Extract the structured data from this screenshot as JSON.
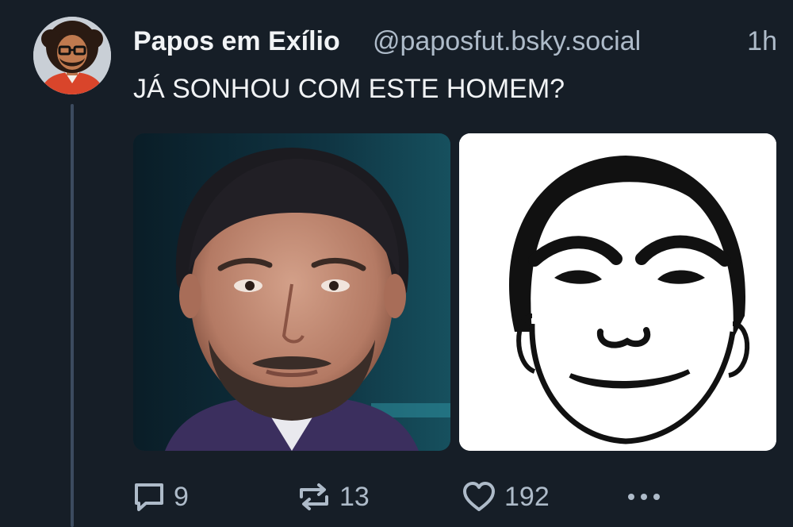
{
  "post": {
    "author": {
      "display_name": "Papos em Exílio",
      "handle": "@paposfut.bsky.social",
      "avatar_icon": "cartoon-avatar"
    },
    "time": "1h",
    "text": "JÁ SONHOU COM ESTE HOMEM?",
    "images": [
      {
        "name": "photo-man-portrait"
      },
      {
        "name": "sketch-this-man-drawing"
      }
    ],
    "actions": {
      "reply": {
        "icon": "reply-icon",
        "count": "9"
      },
      "repost": {
        "icon": "repost-icon",
        "count": "13"
      },
      "like": {
        "icon": "heart-icon",
        "count": "192"
      },
      "more": {
        "icon": "more-options-icon"
      }
    }
  },
  "colors": {
    "background": "#161e27",
    "text_primary": "#f1f3f5",
    "text_secondary": "#aebbc9",
    "thread_line": "#3c4b5f"
  }
}
